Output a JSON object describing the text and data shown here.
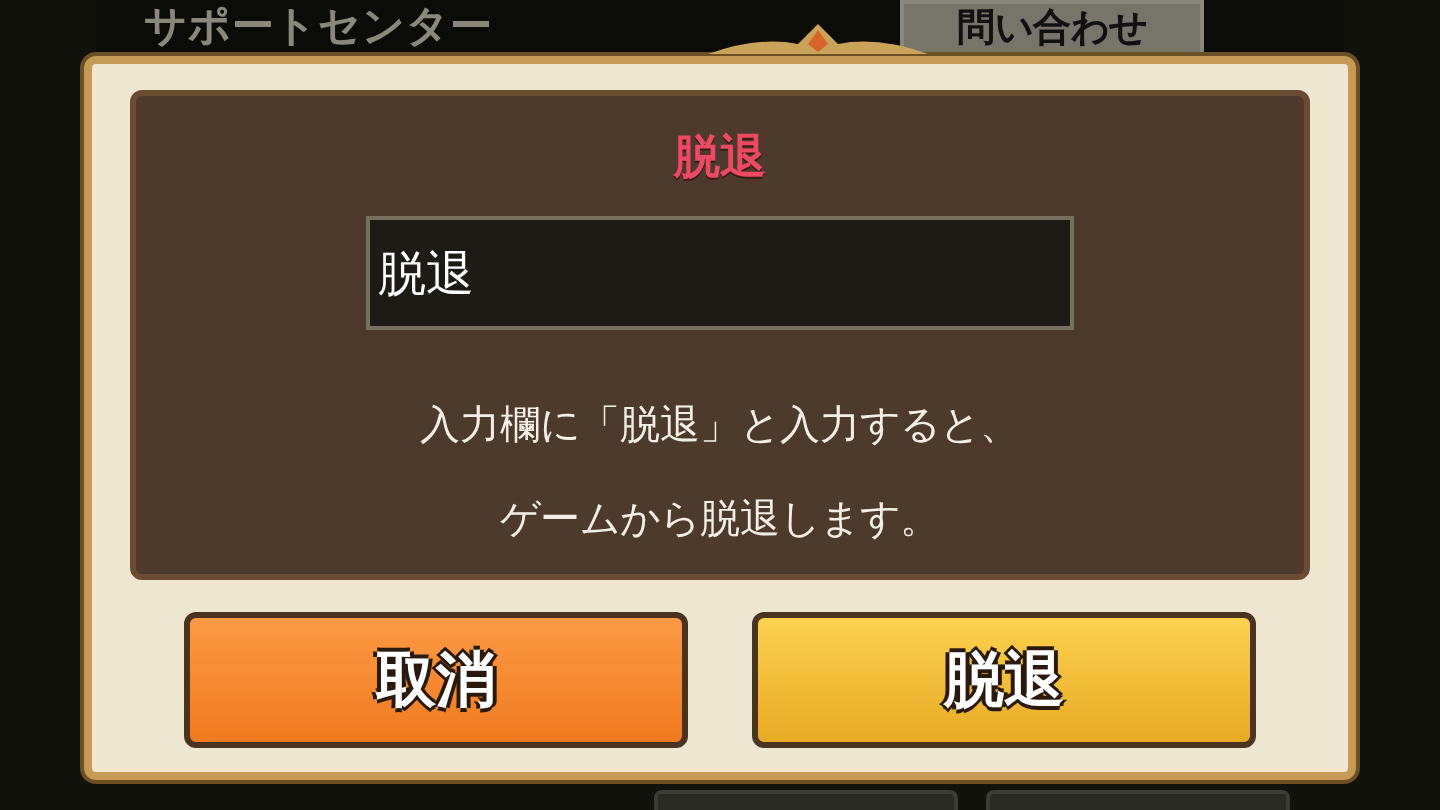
{
  "background": {
    "title": "サポートセンター",
    "button": "問い合わせ"
  },
  "dialog": {
    "title": "脱退",
    "input": {
      "value": "脱退"
    },
    "message": [
      "入力欄に「脱退」と入力すると、",
      "ゲームから脱退します。"
    ],
    "buttons": [
      {
        "label": "取消",
        "kind": "cancel"
      },
      {
        "label": "脱退",
        "kind": "confirm"
      }
    ]
  }
}
